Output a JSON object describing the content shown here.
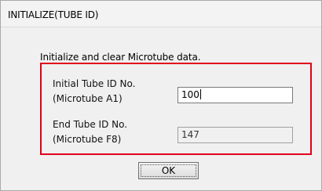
{
  "dialog": {
    "title": "INITIALIZE(TUBE ID)",
    "description": "Initialize and clear Microtube data.",
    "initial": {
      "label_line1": "Initial Tube ID No.",
      "label_line2": "(Microtube A1)",
      "value": "100"
    },
    "end": {
      "label_line1": "End Tube ID No.",
      "label_line2": "(Microtube F8)",
      "value": "147"
    },
    "ok_label": "OK"
  },
  "colors": {
    "highlight": "#e0001b",
    "window_bg": "#f0f0f0"
  }
}
